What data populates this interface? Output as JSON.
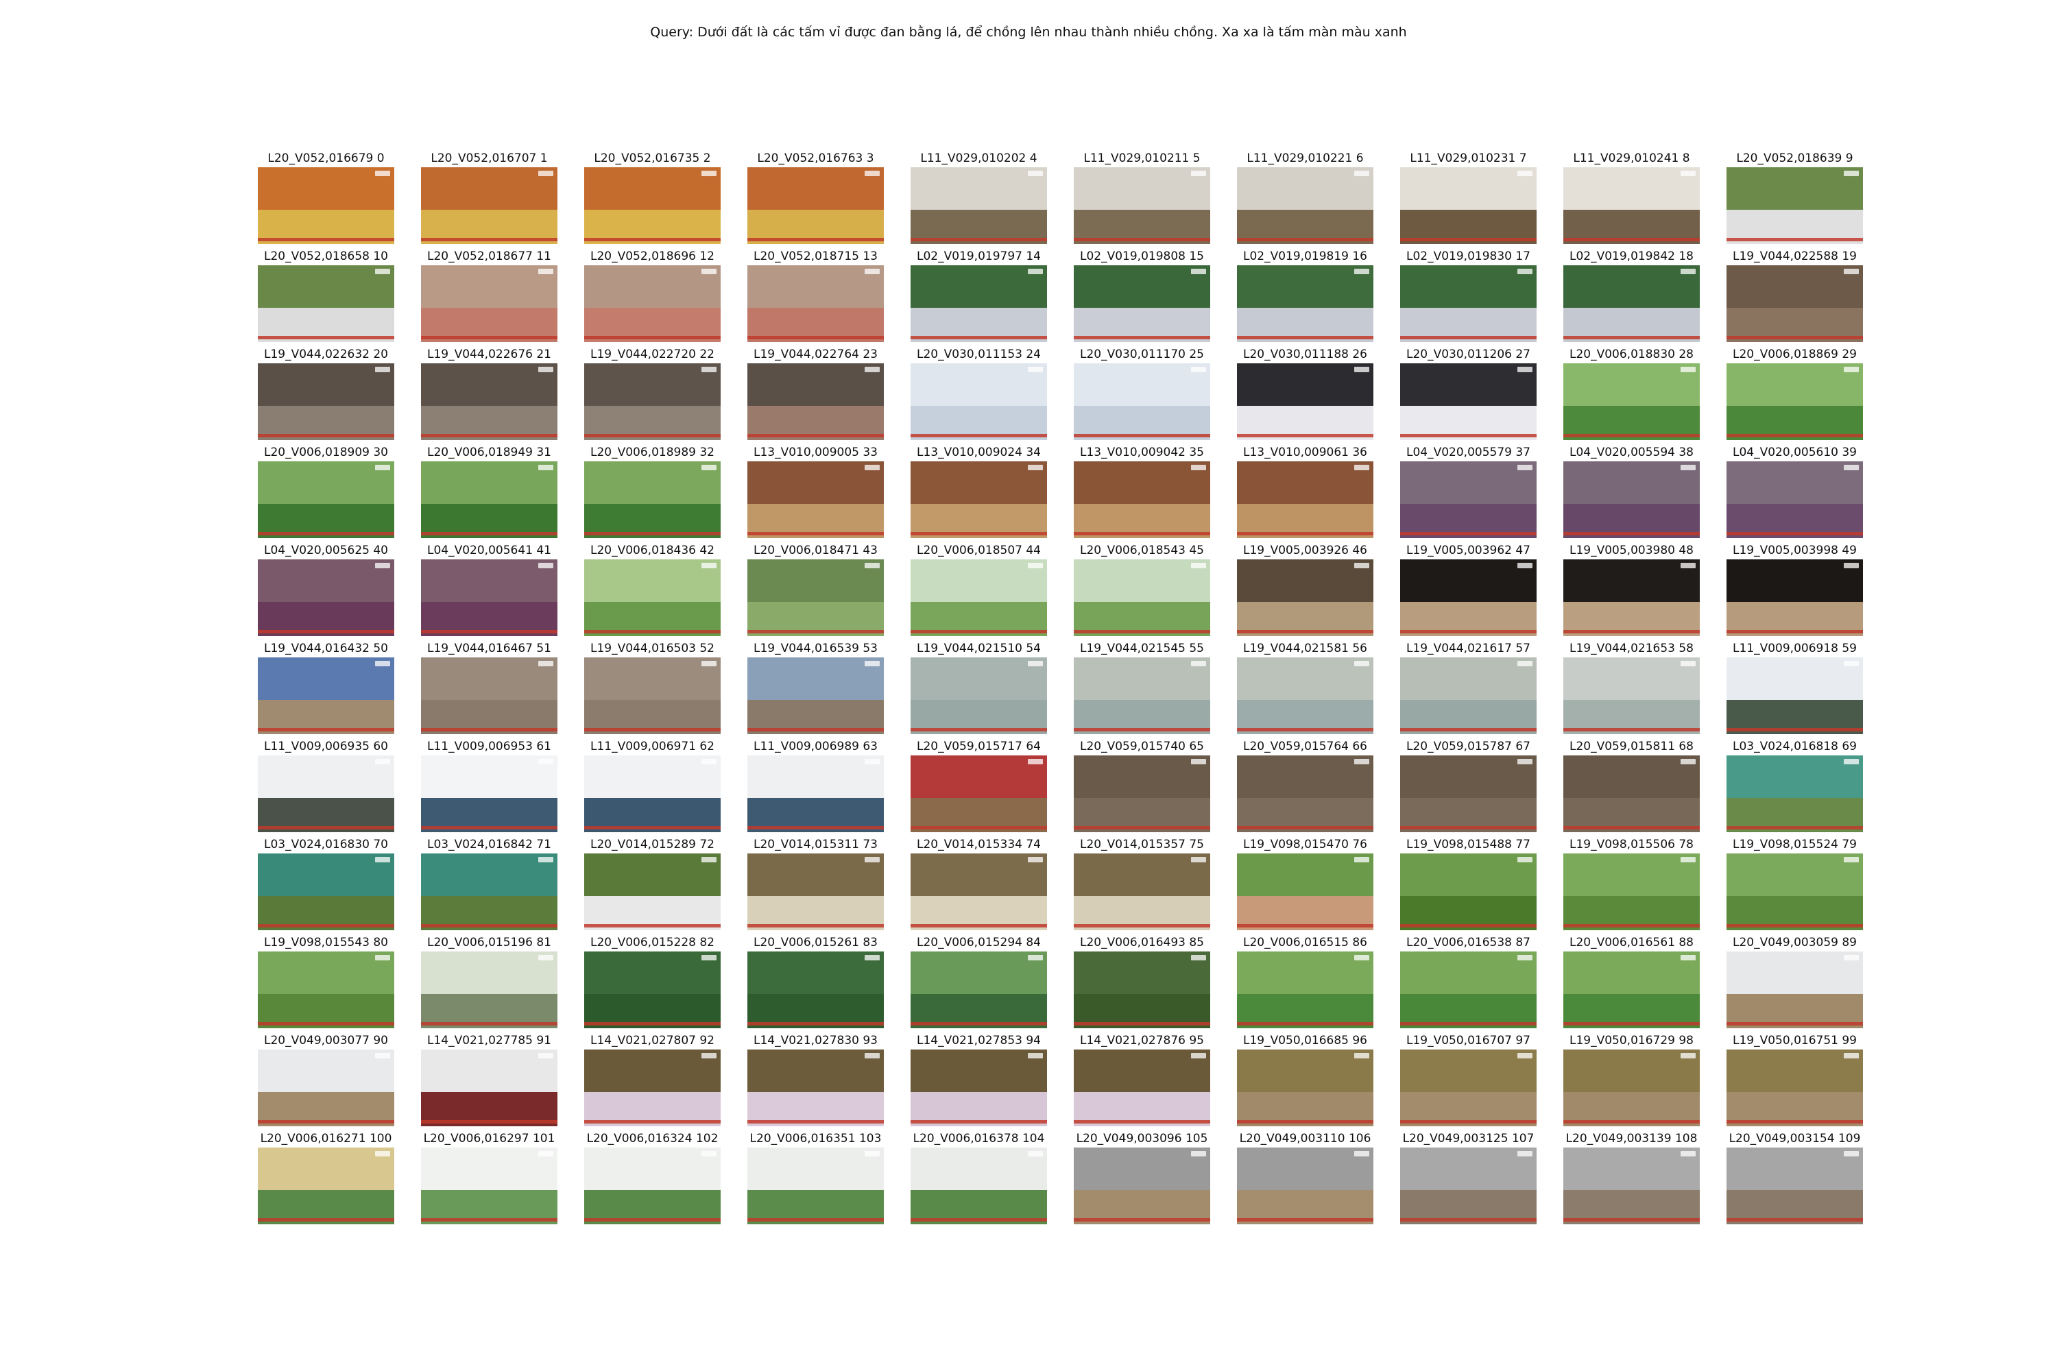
{
  "query": "Query: Dưới đất là các tấm vỉ được đan bằng lá, để chồng lên nhau thành nhiều chồng. Xa xa là tấm màn màu xanh",
  "thumbnails": [
    {
      "label": "L20_V052,016679 0",
      "colors": [
        "#c9702c",
        "#d9b24a"
      ]
    },
    {
      "label": "L20_V052,016707 1",
      "colors": [
        "#c06a30",
        "#d8b04c"
      ]
    },
    {
      "label": "L20_V052,016735 2",
      "colors": [
        "#c46c2e",
        "#dab34b"
      ]
    },
    {
      "label": "L20_V052,016763 3",
      "colors": [
        "#c0682f",
        "#d6ae4a"
      ]
    },
    {
      "label": "L11_V029,010202 4",
      "colors": [
        "#d8d4cc",
        "#7a6a52"
      ]
    },
    {
      "label": "L11_V029,010211 5",
      "colors": [
        "#d6d2ca",
        "#7d6c54"
      ]
    },
    {
      "label": "L11_V029,010221 6",
      "colors": [
        "#d4d0c8",
        "#7b6a50"
      ]
    },
    {
      "label": "L11_V029,010231 7",
      "colors": [
        "#e2ded6",
        "#6e5a40"
      ]
    },
    {
      "label": "L11_V029,010241 8",
      "colors": [
        "#e4e0d8",
        "#72604a"
      ]
    },
    {
      "label": "L20_V052,018639 9",
      "colors": [
        "#6c8a4a",
        "#e0e0e0"
      ]
    },
    {
      "label": "L20_V052,018658 10",
      "colors": [
        "#6a8848",
        "#dcdcdc"
      ]
    },
    {
      "label": "L20_V052,018677 11",
      "colors": [
        "#b89a86",
        "#c27a6a"
      ]
    },
    {
      "label": "L20_V052,018696 12",
      "colors": [
        "#b49684",
        "#c47c6c"
      ]
    },
    {
      "label": "L20_V052,018715 13",
      "colors": [
        "#b69886",
        "#c07868"
      ]
    },
    {
      "label": "L02_V019,019797 14",
      "colors": [
        "#3c6a3a",
        "#c8ccd4"
      ]
    },
    {
      "label": "L02_V019,019808 15",
      "colors": [
        "#3a683a",
        "#cacdd6"
      ]
    },
    {
      "label": "L02_V019,019819 16",
      "colors": [
        "#3e6c3c",
        "#c6cad2"
      ]
    },
    {
      "label": "L02_V019,019830 17",
      "colors": [
        "#3c6a3a",
        "#c8cbd3"
      ]
    },
    {
      "label": "L02_V019,019842 18",
      "colors": [
        "#3a683a",
        "#c4c8d0"
      ]
    },
    {
      "label": "L19_V044,022588 19",
      "colors": [
        "#6e5a48",
        "#8a7460"
      ]
    },
    {
      "label": "L19_V044,022632 20",
      "colors": [
        "#5a5048",
        "#8a7e72"
      ]
    },
    {
      "label": "L19_V044,022676 21",
      "colors": [
        "#5c524a",
        "#8c8074"
      ]
    },
    {
      "label": "L19_V044,022720 22",
      "colors": [
        "#5e544c",
        "#8e8276"
      ]
    },
    {
      "label": "L19_V044,022764 23",
      "colors": [
        "#5a5048",
        "#9a7a6a"
      ]
    },
    {
      "label": "L20_V030,011153 24",
      "colors": [
        "#dfe6ee",
        "#c6d0dc"
      ]
    },
    {
      "label": "L20_V030,011170 25",
      "colors": [
        "#e0e7ef",
        "#c4cedb"
      ]
    },
    {
      "label": "L20_V030,011188 26",
      "colors": [
        "#2c2c30",
        "#e8e8ec"
      ]
    },
    {
      "label": "L20_V030,011206 27",
      "colors": [
        "#2e2e32",
        "#eaeaee"
      ]
    },
    {
      "label": "L20_V006,018830 28",
      "colors": [
        "#8ab86a",
        "#4e8a3c"
      ]
    },
    {
      "label": "L20_V006,018869 29",
      "colors": [
        "#88b668",
        "#4c883a"
      ]
    },
    {
      "label": "L20_V006,018909 30",
      "colors": [
        "#7aa85c",
        "#3e7a32"
      ]
    },
    {
      "label": "L20_V006,018949 31",
      "colors": [
        "#78a65a",
        "#3c7830"
      ]
    },
    {
      "label": "L20_V006,018989 32",
      "colors": [
        "#7ca85e",
        "#3e7c34"
      ]
    },
    {
      "label": "L13_V010,009005 33",
      "colors": [
        "#8a5438",
        "#c09868"
      ]
    },
    {
      "label": "L13_V010,009024 34",
      "colors": [
        "#8c5638",
        "#c29a6a"
      ]
    },
    {
      "label": "L13_V010,009042 35",
      "colors": [
        "#8a5436",
        "#c09666"
      ]
    },
    {
      "label": "L13_V010,009061 36",
      "colors": [
        "#8a5438",
        "#be9464"
      ]
    },
    {
      "label": "L04_V020,005579 37",
      "colors": [
        "#7a6a7a",
        "#6a4a6a"
      ]
    },
    {
      "label": "L04_V020,005594 38",
      "colors": [
        "#786878",
        "#684868"
      ]
    },
    {
      "label": "L04_V020,005610 39",
      "colors": [
        "#7c6c7c",
        "#6c4c6c"
      ]
    },
    {
      "label": "L04_V020,005625 40",
      "colors": [
        "#7a5a6a",
        "#6a3a5a"
      ]
    },
    {
      "label": "L04_V020,005641 41",
      "colors": [
        "#7c5c6c",
        "#6c3c5c"
      ]
    },
    {
      "label": "L20_V006,018436 42",
      "colors": [
        "#a8c88a",
        "#6a9a4c"
      ]
    },
    {
      "label": "L20_V006,018471 43",
      "colors": [
        "#6a8a52",
        "#8aaa6a"
      ]
    },
    {
      "label": "L20_V006,018507 44",
      "colors": [
        "#c8dcc0",
        "#7aa65c"
      ]
    },
    {
      "label": "L20_V006,018543 45",
      "colors": [
        "#c6dabe",
        "#78a45a"
      ]
    },
    {
      "label": "L19_V005,003926 46",
      "colors": [
        "#5a4a3a",
        "#b09a7a"
      ]
    },
    {
      "label": "L19_V005,003962 47",
      "colors": [
        "#1e1a18",
        "#b89e7e"
      ]
    },
    {
      "label": "L19_V005,003980 48",
      "colors": [
        "#201c1a",
        "#ba9f80"
      ]
    },
    {
      "label": "L19_V005,003998 49",
      "colors": [
        "#1c1816",
        "#b69c7c"
      ]
    },
    {
      "label": "L19_V044,016432 50",
      "colors": [
        "#5a7ab0",
        "#a08a70"
      ]
    },
    {
      "label": "L19_V044,016467 51",
      "colors": [
        "#9a8a7c",
        "#8a7a6c"
      ]
    },
    {
      "label": "L19_V044,016503 52",
      "colors": [
        "#9c8c7e",
        "#8c7c6e"
      ]
    },
    {
      "label": "L19_V044,016539 53",
      "colors": [
        "#8aa0b8",
        "#8a7a6a"
      ]
    },
    {
      "label": "L19_V044,021510 54",
      "colors": [
        "#a8b4b0",
        "#98a8a4"
      ]
    },
    {
      "label": "L19_V044,021545 55",
      "colors": [
        "#b8c0b8",
        "#9aaaa6"
      ]
    },
    {
      "label": "L19_V044,021581 56",
      "colors": [
        "#bac2ba",
        "#9cacaa"
      ]
    },
    {
      "label": "L19_V044,021617 57",
      "colors": [
        "#b6beb6",
        "#98a8a4"
      ]
    },
    {
      "label": "L19_V044,021653 58",
      "colors": [
        "#c8ccc8",
        "#a4b0ac"
      ]
    },
    {
      "label": "L11_V009,006918 59",
      "colors": [
        "#e8ecf0",
        "#4a5a4a"
      ]
    },
    {
      "label": "L11_V009,006935 60",
      "colors": [
        "#eef0f2",
        "#4a524a"
      ]
    },
    {
      "label": "L11_V009,006953 61",
      "colors": [
        "#f2f4f6",
        "#3e5a72"
      ]
    },
    {
      "label": "L11_V009,006971 62",
      "colors": [
        "#f0f2f4",
        "#3c5870"
      ]
    },
    {
      "label": "L11_V009,006989 63",
      "colors": [
        "#eef0f2",
        "#3e5a72"
      ]
    },
    {
      "label": "L20_V059,015717 64",
      "colors": [
        "#b43a3a",
        "#8a6a4a"
      ]
    },
    {
      "label": "L20_V059,015740 65",
      "colors": [
        "#6a5a4a",
        "#7a6a5a"
      ]
    },
    {
      "label": "L20_V059,015764 66",
      "colors": [
        "#6c5c4c",
        "#7c6c5c"
      ]
    },
    {
      "label": "L20_V059,015787 67",
      "colors": [
        "#6a5a4a",
        "#7a6a5a"
      ]
    },
    {
      "label": "L20_V059,015811 68",
      "colors": [
        "#68584a",
        "#786858"
      ]
    },
    {
      "label": "L03_V024,016818 69",
      "colors": [
        "#4a9a8a",
        "#6a8a4a"
      ]
    },
    {
      "label": "L03_V024,016830 70",
      "colors": [
        "#3a8a7a",
        "#5a7a3a"
      ]
    },
    {
      "label": "L03_V024,016842 71",
      "colors": [
        "#3c8c7c",
        "#5c7c3c"
      ]
    },
    {
      "label": "L20_V014,015289 72",
      "colors": [
        "#5a7a3a",
        "#e8e8e8"
      ]
    },
    {
      "label": "L20_V014,015311 73",
      "colors": [
        "#7a6a4a",
        "#d8d0b8"
      ]
    },
    {
      "label": "L20_V014,015334 74",
      "colors": [
        "#7c6c4c",
        "#dad2ba"
      ]
    },
    {
      "label": "L20_V014,015357 75",
      "colors": [
        "#7a6a4a",
        "#d6ceb6"
      ]
    },
    {
      "label": "L19_V098,015470 76",
      "colors": [
        "#6a9a4a",
        "#c89a7a"
      ]
    },
    {
      "label": "L19_V098,015488 77",
      "colors": [
        "#6c9c4c",
        "#4a7a2a"
      ]
    },
    {
      "label": "L19_V098,015506 78",
      "colors": [
        "#7aaa5a",
        "#5a8a3a"
      ]
    },
    {
      "label": "L19_V098,015524 79",
      "colors": [
        "#7caa5c",
        "#5c8a3c"
      ]
    },
    {
      "label": "L19_V098,015543 80",
      "colors": [
        "#7aa85a",
        "#5a883a"
      ]
    },
    {
      "label": "L20_V006,015196 81",
      "colors": [
        "#d8e0d0",
        "#7a8a6a"
      ]
    },
    {
      "label": "L20_V006,015228 82",
      "colors": [
        "#3a6a3a",
        "#2c5a2c"
      ]
    },
    {
      "label": "L20_V006,015261 83",
      "colors": [
        "#3c6c3c",
        "#2e5c2e"
      ]
    },
    {
      "label": "L20_V006,015294 84",
      "colors": [
        "#6a9a5a",
        "#3a6a3a"
      ]
    },
    {
      "label": "L20_V006,016493 85",
      "colors": [
        "#4a6a3a",
        "#3a5a2a"
      ]
    },
    {
      "label": "L20_V006,016515 86",
      "colors": [
        "#7aaa5a",
        "#4a8a3a"
      ]
    },
    {
      "label": "L20_V006,016538 87",
      "colors": [
        "#78a858",
        "#488838"
      ]
    },
    {
      "label": "L20_V006,016561 88",
      "colors": [
        "#7aaa5a",
        "#4a8a3a"
      ]
    },
    {
      "label": "L20_V049,003059 89",
      "colors": [
        "#e6e8ea",
        "#a08a6a"
      ]
    },
    {
      "label": "L20_V049,003077 90",
      "colors": [
        "#e8eaec",
        "#a28c6c"
      ]
    },
    {
      "label": "L14_V021,027785 91",
      "colors": [
        "#e8e8e8",
        "#7a2a2a"
      ]
    },
    {
      "label": "L14_V021,027807 92",
      "colors": [
        "#6a5a3a",
        "#d8c8d8"
      ]
    },
    {
      "label": "L14_V021,027830 93",
      "colors": [
        "#6c5c3c",
        "#dacada"
      ]
    },
    {
      "label": "L14_V021,027853 94",
      "colors": [
        "#6a5a3a",
        "#d6c6d6"
      ]
    },
    {
      "label": "L14_V021,027876 95",
      "colors": [
        "#6a5a3a",
        "#d8c8d8"
      ]
    },
    {
      "label": "L19_V050,016685 96",
      "colors": [
        "#8a7a4a",
        "#a08a6a"
      ]
    },
    {
      "label": "L19_V050,016707 97",
      "colors": [
        "#8c7c4c",
        "#a28c6c"
      ]
    },
    {
      "label": "L19_V050,016729 98",
      "colors": [
        "#8a7a4a",
        "#a08a6a"
      ]
    },
    {
      "label": "L19_V050,016751 99",
      "colors": [
        "#8c7c4c",
        "#a28c6c"
      ]
    },
    {
      "label": "L20_V006,016271 100",
      "colors": [
        "#d8c890",
        "#5a8a4a"
      ]
    },
    {
      "label": "L20_V006,016297 101",
      "colors": [
        "#f0f2f0",
        "#6a9a5a"
      ]
    },
    {
      "label": "L20_V006,016324 102",
      "colors": [
        "#eef0ee",
        "#5a8a4a"
      ]
    },
    {
      "label": "L20_V006,016351 103",
      "colors": [
        "#eceeec",
        "#5c8c4c"
      ]
    },
    {
      "label": "L20_V006,016378 104",
      "colors": [
        "#eaecea",
        "#5a8a4a"
      ]
    },
    {
      "label": "L20_V049,003096 105",
      "colors": [
        "#9a9a9a",
        "#a28c6c"
      ]
    },
    {
      "label": "L20_V049,003110 106",
      "colors": [
        "#9c9c9c",
        "#a48e6e"
      ]
    },
    {
      "label": "L20_V049,003125 107",
      "colors": [
        "#a8a8a8",
        "#8a7a6a"
      ]
    },
    {
      "label": "L20_V049,003139 108",
      "colors": [
        "#aaaaaa",
        "#8c7c6c"
      ]
    },
    {
      "label": "L20_V049,003154 109",
      "colors": [
        "#a6a6a6",
        "#8a7a6a"
      ]
    }
  ]
}
